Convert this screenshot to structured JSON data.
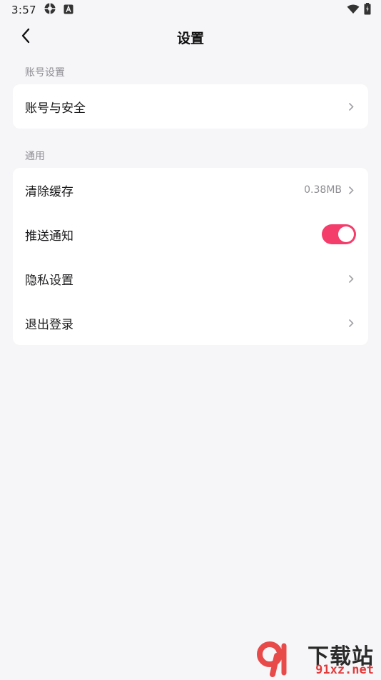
{
  "status_bar": {
    "time": "3:57",
    "icons": [
      "settings-sync-icon",
      "a-badge-icon",
      "wifi-icon",
      "battery-icon"
    ]
  },
  "header": {
    "title": "设置",
    "back_icon": "chevron-left-icon"
  },
  "sections": [
    {
      "label": "账号设置",
      "items": [
        {
          "label": "账号与安全",
          "type": "link"
        }
      ]
    },
    {
      "label": "通用",
      "items": [
        {
          "label": "清除缓存",
          "type": "link",
          "value": "0.38MB"
        },
        {
          "label": "推送通知",
          "type": "toggle",
          "on": true
        },
        {
          "label": "隐私设置",
          "type": "link"
        },
        {
          "label": "退出登录",
          "type": "link"
        }
      ]
    }
  ],
  "watermark": {
    "top_text": "下载站",
    "bottom_text": "91xz.net"
  },
  "colors": {
    "accent": "#f53d6b",
    "background": "#f6f6f9",
    "card": "#ffffff",
    "muted_text": "#8e8e93"
  }
}
